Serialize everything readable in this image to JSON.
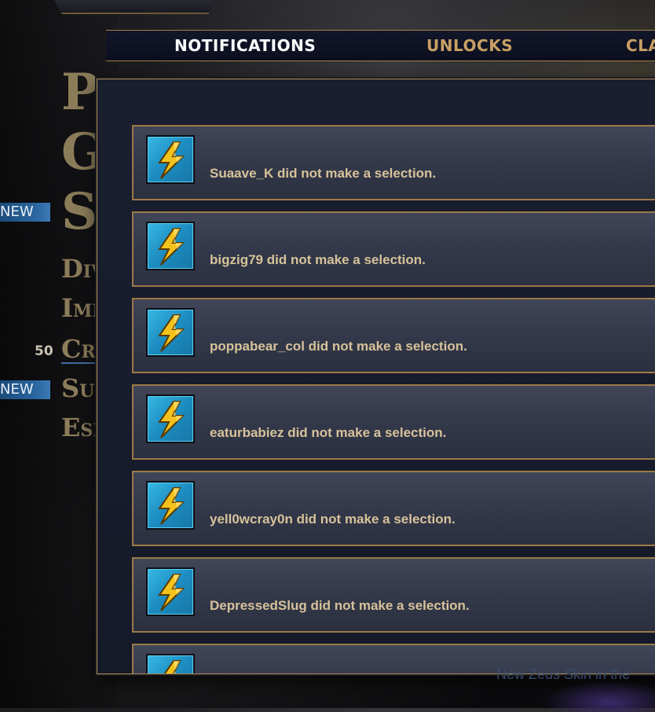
{
  "tabs": [
    {
      "label": "NOTIFICATIONS",
      "active": true
    },
    {
      "label": "UNLOCKS",
      "active": false
    },
    {
      "label": "CLA",
      "active": false
    }
  ],
  "menu": {
    "play": "Play",
    "gods": "Go",
    "store": "Sto",
    "divine": "Divine",
    "immortal": "Immor",
    "cross": "Cross",
    "summer": "Summe",
    "esports": "Esport"
  },
  "badges": {
    "store_new": "NEW",
    "summer_new": "NEW",
    "cross_count": "50"
  },
  "notifications": [
    {
      "text": "Suaave_K did not make a selection.",
      "icon": "lightning-bolt-icon"
    },
    {
      "text": "bigzig79 did not make a selection.",
      "icon": "lightning-bolt-icon"
    },
    {
      "text": "poppabear_col did not make a selection.",
      "icon": "lightning-bolt-icon"
    },
    {
      "text": "eaturbabiez did not make a selection.",
      "icon": "lightning-bolt-icon"
    },
    {
      "text": "yell0wcray0n did not make a selection.",
      "icon": "lightning-bolt-icon"
    },
    {
      "text": "DepressedSlug did not make a selection.",
      "icon": "lightning-bolt-icon"
    },
    {
      "text": "",
      "icon": "lightning-bolt-icon"
    }
  ],
  "teaser": "New Zeus Skin in the",
  "colors": {
    "accent_gold": "#b38f58",
    "text_gold": "#d7c29a",
    "tab_inactive": "#c8a064",
    "icon_blue": "#1c8cc0",
    "badge_blue": "#2a66a0"
  }
}
